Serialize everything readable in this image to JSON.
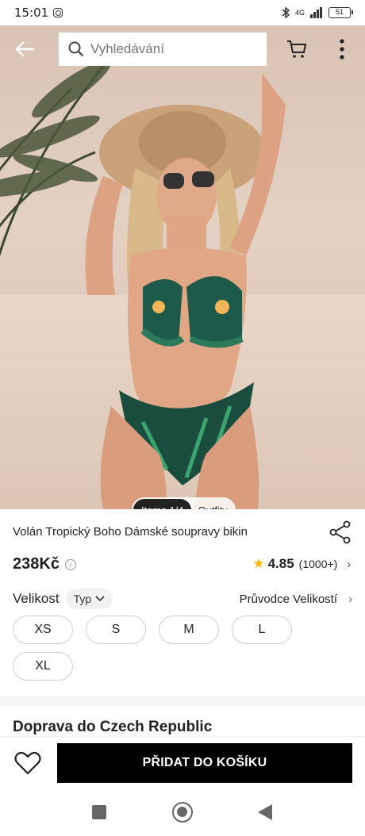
{
  "status_bar": {
    "time": "15:01",
    "network": "4G",
    "battery": "51"
  },
  "search": {
    "placeholder": "Vyhledávání"
  },
  "image_toggle": {
    "items_label": "Items 1/4",
    "outfits_label": "Outfity"
  },
  "product": {
    "title": "Volán Tropický Boho Dámské soupravy bikin",
    "price": "238Kč",
    "rating": "4.85",
    "rating_count": "(1000+)"
  },
  "size_section": {
    "label": "Velikost",
    "type_chip": "Typ",
    "guide_label": "Průvodce Velikostí",
    "sizes": [
      "XS",
      "S",
      "M",
      "L",
      "XL"
    ]
  },
  "shipping": {
    "title": "Doprava do Czech Republic"
  },
  "actions": {
    "add_to_cart": "PŘIDAT DO KOŠÍKU"
  },
  "icons": {
    "back": "back-arrow-icon",
    "search": "search-icon",
    "cart": "cart-icon",
    "more": "more-vertical-icon",
    "share": "share-icon",
    "info": "info-icon",
    "star": "star-icon",
    "wishlist": "heart-icon"
  },
  "colors": {
    "accent_star": "#f5b400",
    "primary_button": "#000000"
  }
}
